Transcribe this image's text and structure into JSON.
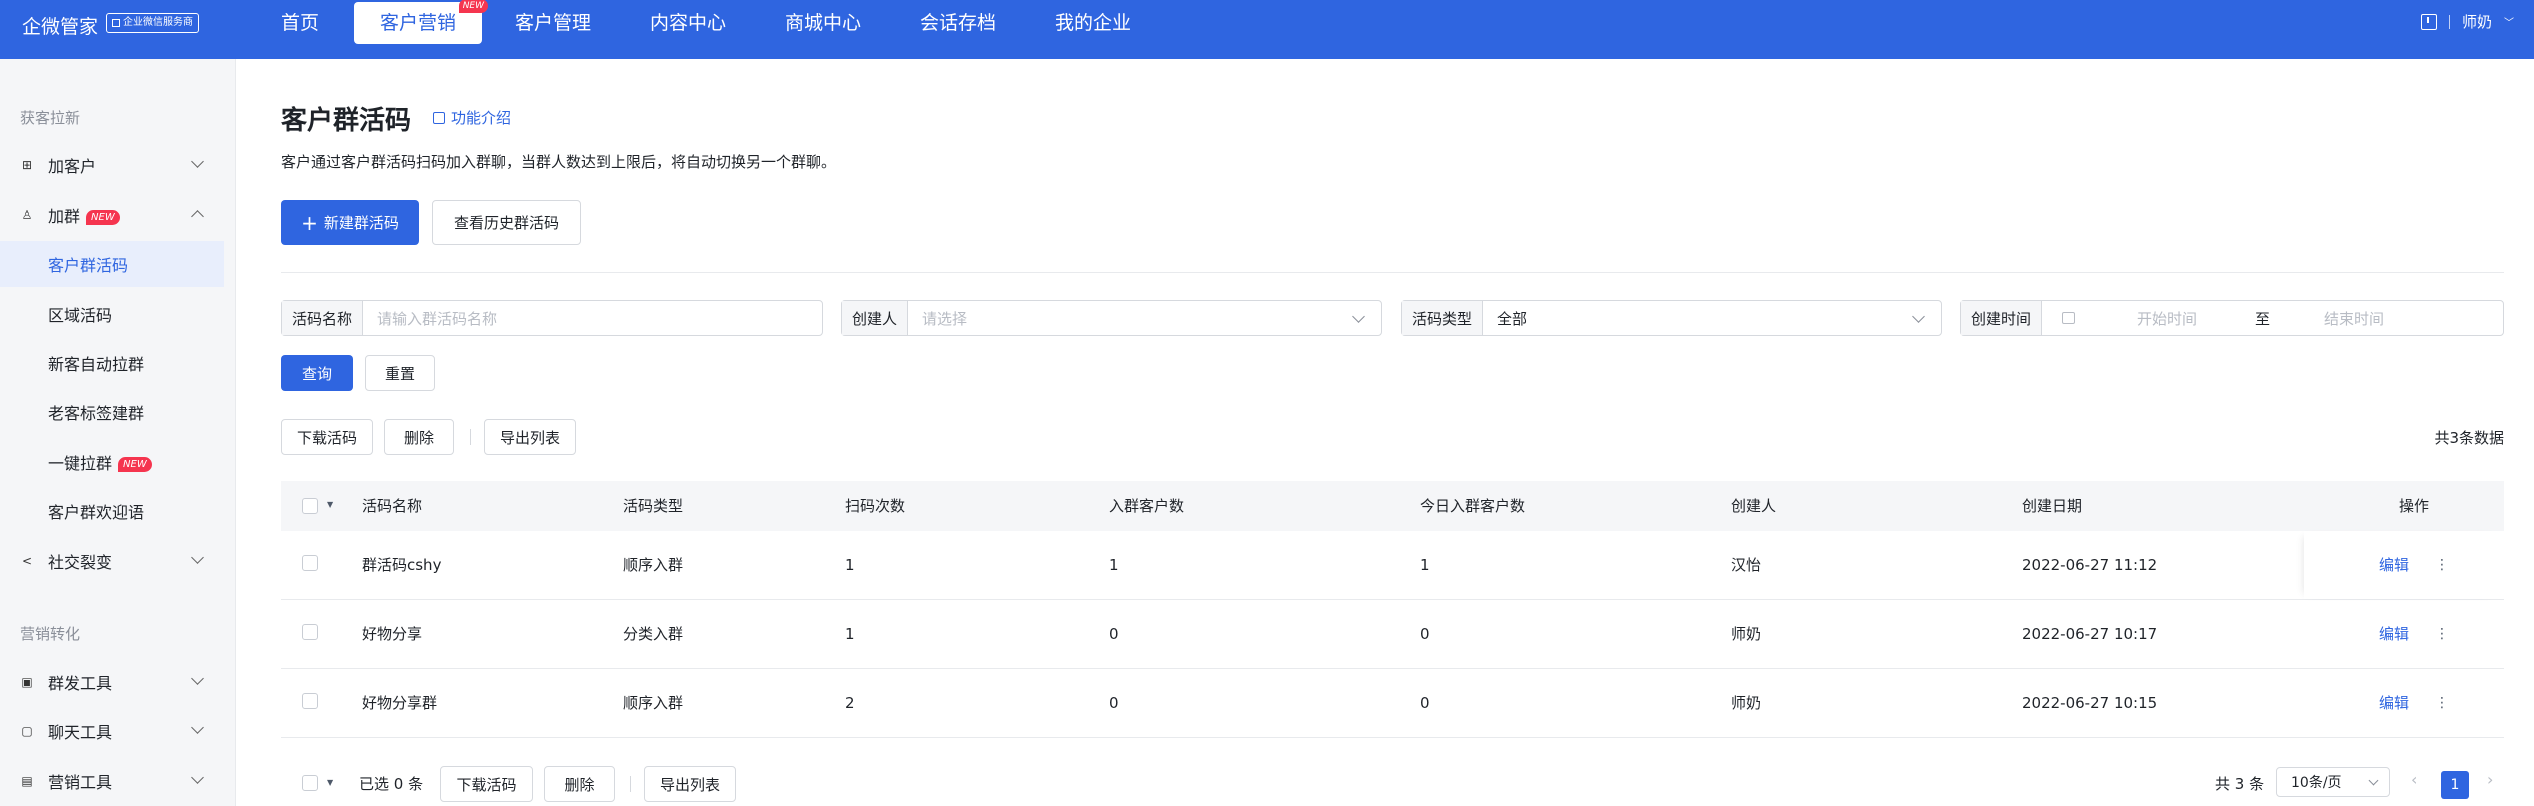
{
  "topbar": {
    "brand": "企微管家",
    "badge": "企业微信服务商",
    "nav": [
      {
        "label": "首页"
      },
      {
        "label": "客户营销",
        "tag": "NEW"
      },
      {
        "label": "客户管理"
      },
      {
        "label": "内容中心"
      },
      {
        "label": "商城中心"
      },
      {
        "label": "会话存档"
      },
      {
        "label": "我的企业"
      }
    ],
    "user": "师奶"
  },
  "sidebar": {
    "group1": "获客拉新",
    "group2": "营销转化",
    "items": {
      "add_customer": "加客户",
      "add_group": "加群",
      "add_group_tag": "NEW",
      "group_code": "客户群活码",
      "area_code": "区域活码",
      "auto_pull": "新客自动拉群",
      "tag_group": "老客标签建群",
      "one_click": "一键拉群",
      "one_click_tag": "NEW",
      "welcome": "客户群欢迎语",
      "social": "社交裂变",
      "mass_send": "群发工具",
      "chat_tools": "聊天工具",
      "marketing_tools": "营销工具"
    }
  },
  "main": {
    "title": "客户群活码",
    "intro": "功能介绍",
    "desc": "客户通过客户群活码扫码加入群聊，当群人数达到上限后，将自动切换另一个群聊。",
    "btn_new": "新建群活码",
    "btn_history": "查看历史群活码",
    "filters": {
      "name_label": "活码名称",
      "name_placeholder": "请输入群活码名称",
      "creator_label": "创建人",
      "creator_placeholder": "请选择",
      "type_label": "活码类型",
      "type_value": "全部",
      "time_label": "创建时间",
      "start": "开始时间",
      "to": "至",
      "end": "结束时间"
    },
    "btn_query": "查询",
    "btn_reset": "重置",
    "btn_download": "下载活码",
    "btn_delete": "删除",
    "btn_export": "导出列表",
    "total": "共3条数据"
  },
  "table": {
    "headers": [
      "活码名称",
      "活码类型",
      "扫码次数",
      "入群客户数",
      "今日入群客户数",
      "创建人",
      "创建日期",
      "操作"
    ],
    "rows": [
      {
        "name": "群活码cshy",
        "type": "顺序入群",
        "scans": "1",
        "joined": "1",
        "today": "1",
        "creator": "汉怡",
        "date": "2022-06-27 11:12",
        "action": "编辑"
      },
      {
        "name": "好物分享",
        "type": "分类入群",
        "scans": "1",
        "joined": "0",
        "today": "0",
        "creator": "师奶",
        "date": "2022-06-27 10:17",
        "action": "编辑"
      },
      {
        "name": "好物分享群",
        "type": "顺序入群",
        "scans": "2",
        "joined": "0",
        "today": "0",
        "creator": "师奶",
        "date": "2022-06-27 10:15",
        "action": "编辑"
      }
    ]
  },
  "footer": {
    "selected": "已选 0 条",
    "btn_download": "下载活码",
    "btn_delete": "删除",
    "btn_export": "导出列表",
    "total": "共 3 条",
    "page_size": "10条/页",
    "current_page": "1"
  },
  "colors": {
    "primary": "#2f65e0",
    "tag": "#f5354f"
  }
}
